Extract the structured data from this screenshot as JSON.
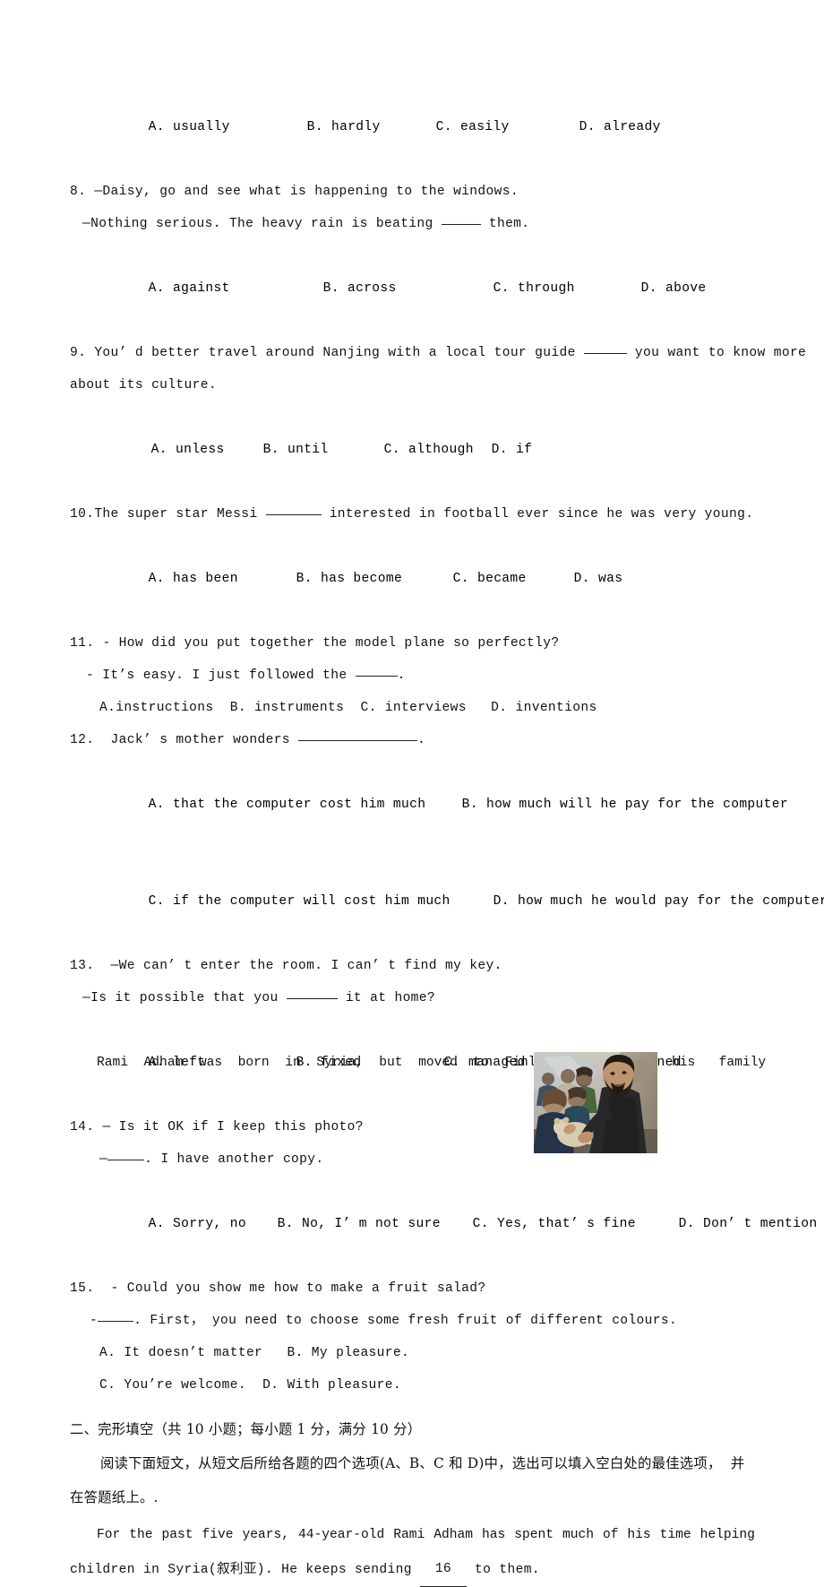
{
  "page": {
    "background": "#ffffff",
    "text_color": "#111111"
  },
  "q7_options": {
    "a": "A. usually",
    "b": "B. hardly",
    "c": "C. easily",
    "d": "D. already"
  },
  "q8": {
    "number": "8.",
    "stem_line1": "—Daisy, go and see what is happening to the windows.",
    "stem_line2_pre": "—Nothing serious. The heavy rain is beating",
    "stem_line2_post": "them.",
    "options": {
      "a": "A. against",
      "b": "B. across",
      "c": "C. through",
      "d": "D. above"
    }
  },
  "q9": {
    "number": "9.",
    "stem_line1_pre": "You’ d better travel around Nanjing with a local tour guide",
    "stem_line1_post": "you want to know more",
    "stem_line2": "about its culture.",
    "options": {
      "a": "A. unless",
      "b": "B. until",
      "c": "C. although",
      "d": "D. if"
    }
  },
  "q10": {
    "number": "10.",
    "stem_pre": "The super star Messi",
    "stem_post": "interested in football ever since he was very young.",
    "options": {
      "a": "A. has been",
      "b": "B. has become",
      "c": "C. became",
      "d": "D. was"
    }
  },
  "q11": {
    "number": "11.",
    "stem_line1": "- How did you put together the model plane so perfectly?",
    "stem_line2_pre": "- It’s easy. I just followed the",
    "stem_line2_post": ".",
    "options_line": "A.instructions  B. instruments  C. interviews   D. inventions"
  },
  "q12": {
    "number": "12.",
    "stem_pre": "Jack’ s mother wonders",
    "stem_post": ".",
    "options": {
      "a": "A. that the computer cost him much",
      "b": "B. how much will he pay for the computer",
      "c": "C. if the computer will cost him much",
      "d": "D. how much he would pay for the computer"
    }
  },
  "q13": {
    "number": "13.",
    "stem_line1": "—We can’ t enter the room. I can’ t find my key.",
    "stem_line2_pre": "—Is it possible that you",
    "stem_line2_post": "it at home?",
    "options": {
      "a": "A. left",
      "b": "B. fixed",
      "c": "C. managed",
      "d": "D. designed"
    }
  },
  "q14": {
    "number": "14.",
    "stem_line1": "— Is it OK if I keep this photo?",
    "stem_line2_pre": "—",
    "stem_line2_post": ". I have another copy.",
    "options": {
      "a": "A. Sorry, no",
      "b": "B. No, I’ m not sure",
      "c": "C. Yes, that’ s fine",
      "d": "D. Don’ t mention it"
    }
  },
  "q15": {
    "number": "15.",
    "stem_line1": "- Could you show me how to make a fruit salad?",
    "stem_line2_pre": "-",
    "stem_line2_post": ". First， you need to choose some fresh fruit of different colours.",
    "options_line1": "A. It doesn’t matter   B. My pleasure.",
    "options_line2": "C. You’re welcome.  D. With pleasure."
  },
  "section2": {
    "heading": "二、完形填空（共 10 小题；每小题 1 分，满分 10 分）",
    "instruction_line1": "阅读下面短文，从短文后所给各题的四个选项(A、B、C 和 D)中，选出可以填入空白处的最佳选项，  并",
    "instruction_line2": "在答题纸上。."
  },
  "passage": {
    "p1_line1_words": [
      "For",
      "the",
      "past",
      "five",
      "years,",
      "44-year-old",
      "Rami",
      "Adham",
      "has",
      "spent",
      "much",
      "of",
      "his",
      "time",
      "helping"
    ],
    "p1_line2_pre": "children in Syria(叙利亚). He keeps sending",
    "p1_line2_blank": "16",
    "p1_line2_post": "to them.",
    "p2_line1_left_words": [
      "Rami",
      "Adham",
      "was",
      "born",
      "in",
      "Syria,",
      "but",
      "moved",
      "to",
      "Finland",
      "with"
    ],
    "p2_line1_right_words": [
      "his",
      "family"
    ]
  },
  "photo": {
    "alt": "Rami Adham handing a teddy bear to children at a refugee camp"
  }
}
